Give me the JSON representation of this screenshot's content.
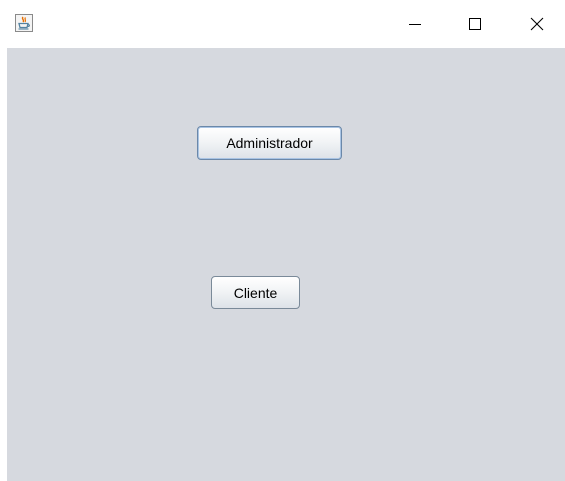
{
  "window": {
    "title": "",
    "controls": {
      "minimize": "minimize-icon",
      "maximize": "maximize-icon",
      "close": "close-icon"
    },
    "app_icon": "java-cup-icon"
  },
  "content": {
    "background": "#d6d9df",
    "buttons": {
      "admin_label": "Administrador",
      "cliente_label": "Cliente"
    }
  }
}
